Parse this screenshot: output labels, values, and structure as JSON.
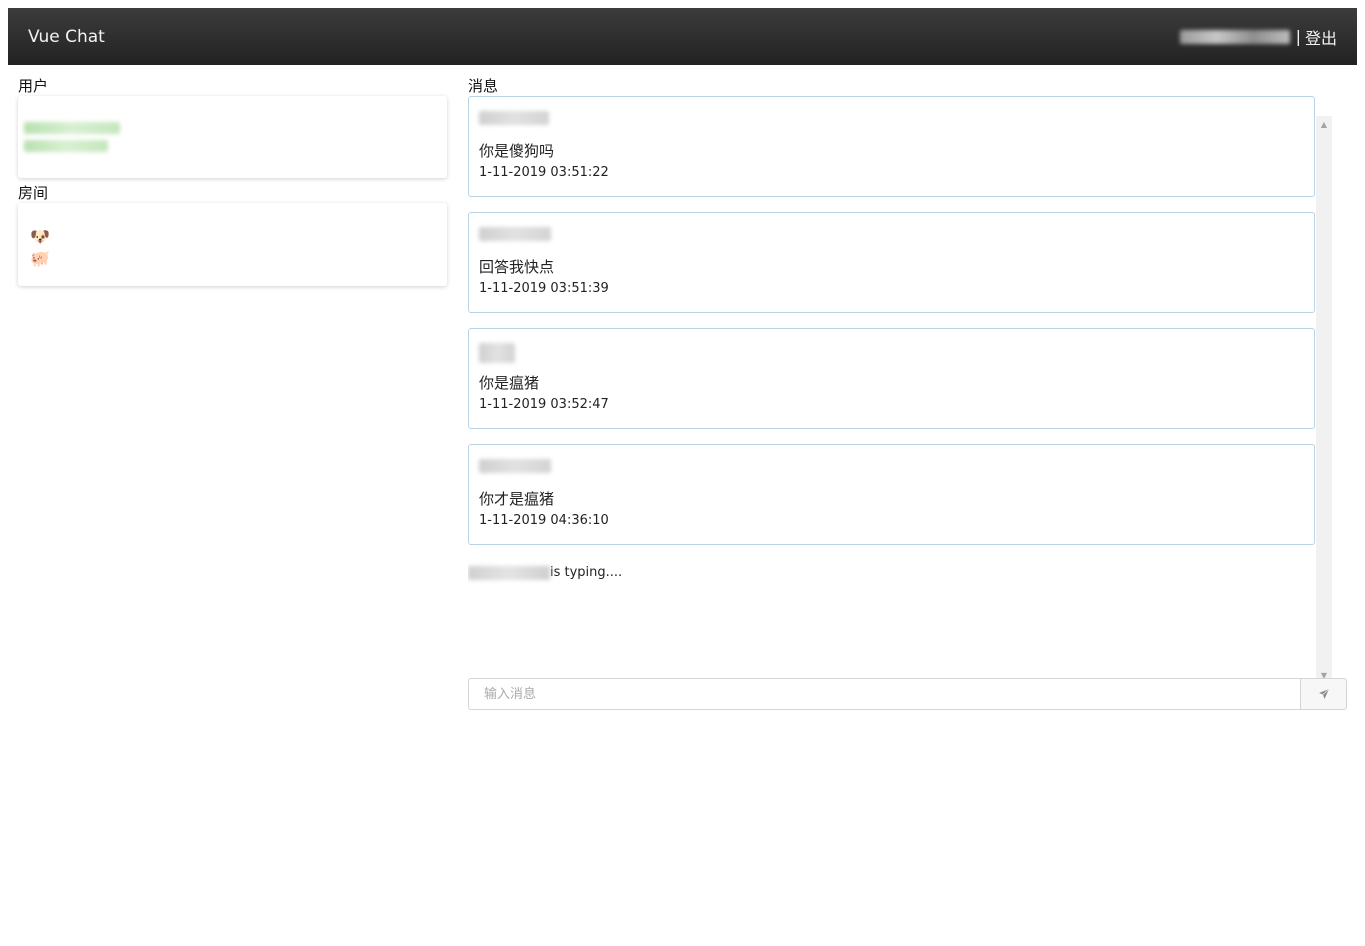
{
  "navbar": {
    "brand": "Vue Chat",
    "separator": "|",
    "logout_label": "登出"
  },
  "sidebar": {
    "users_label": "用户",
    "rooms_label": "房间",
    "rooms": [
      {
        "icon": "dog-icon",
        "glyph": "🐶"
      },
      {
        "icon": "pig-icon",
        "glyph": "🐖"
      }
    ]
  },
  "messages_label": "消息",
  "messages": [
    {
      "text": "你是傻狗吗",
      "time": "1-11-2019 03:51:22"
    },
    {
      "text": "回答我快点",
      "time": "1-11-2019 03:51:39"
    },
    {
      "text": "你是瘟猪",
      "time": "1-11-2019 03:52:47"
    },
    {
      "text": "你才是瘟猪",
      "time": "1-11-2019 04:36:10"
    }
  ],
  "typing_text": "is typing....",
  "composer": {
    "placeholder": "输入消息",
    "send_icon": "paper-plane-icon"
  }
}
